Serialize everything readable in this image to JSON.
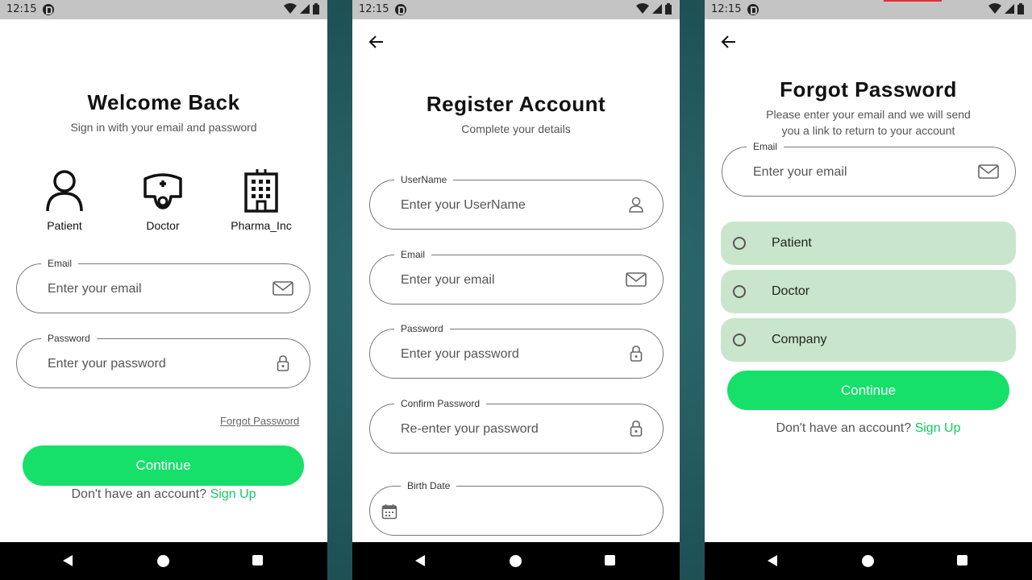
{
  "status_bar": {
    "time": "12:15"
  },
  "login": {
    "title": "Welcome Back",
    "subtitle": "Sign in with your email and password",
    "roles": [
      {
        "label": "Patient",
        "icon": "person-icon"
      },
      {
        "label": "Doctor",
        "icon": "nurse-cap-icon"
      },
      {
        "label": "Pharma_Inc",
        "icon": "building-icon"
      }
    ],
    "email": {
      "label": "Email",
      "placeholder": "Enter your email",
      "icon": "mail-icon"
    },
    "password": {
      "label": "Password",
      "placeholder": "Enter your password",
      "icon": "lock-icon"
    },
    "forgot_password": "Forgot Password",
    "continue_label": "Continue",
    "no_account_text": "Don't have an account?",
    "sign_up_label": "Sign Up"
  },
  "register": {
    "title": "Register Account",
    "subtitle": "Complete your details",
    "username": {
      "label": "UserName",
      "placeholder": "Enter your UserName",
      "icon": "user-icon"
    },
    "email": {
      "label": "Email",
      "placeholder": "Enter your email",
      "icon": "mail-icon"
    },
    "password": {
      "label": "Password",
      "placeholder": "Enter your password",
      "icon": "lock-icon"
    },
    "confirm_password": {
      "label": "Confirm Password",
      "placeholder": "Re-enter your password",
      "icon": "lock-icon"
    },
    "birth_date": {
      "label": "Birth Date",
      "icon": "calendar-icon"
    }
  },
  "forgot": {
    "title": "Forgot Password",
    "subtitle_line1": "Please enter your email and we will send",
    "subtitle_line2": "you a link to return to your account",
    "email": {
      "label": "Email",
      "placeholder": "Enter your email",
      "icon": "mail-icon"
    },
    "options": [
      "Patient",
      "Doctor",
      "Company"
    ],
    "continue_label": "Continue",
    "no_account_text": "Don't have an account?",
    "sign_up_label": "Sign Up"
  },
  "colors": {
    "accent": "#16e06a",
    "link": "#16c964",
    "radio_background": "#c9e6cc",
    "backdrop": "#245b5f"
  }
}
